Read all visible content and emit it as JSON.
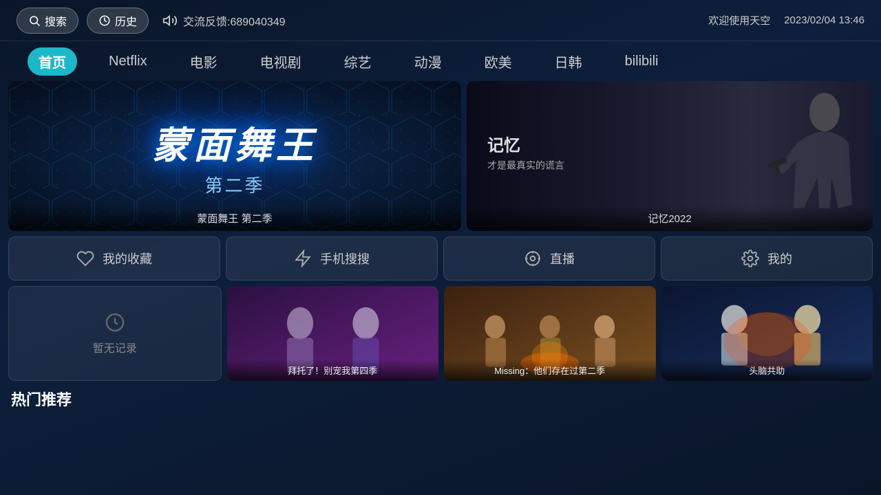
{
  "topbar": {
    "search_label": "搜索",
    "history_label": "历史",
    "feedback_text": "交流反馈:689040349",
    "welcome_text": "欢迎使用天空",
    "datetime": "2023/02/04 13:46"
  },
  "nav": {
    "items": [
      {
        "id": "home",
        "label": "首页",
        "active": true
      },
      {
        "id": "netflix",
        "label": "Netflix",
        "active": false
      },
      {
        "id": "movie",
        "label": "电影",
        "active": false
      },
      {
        "id": "tv",
        "label": "电视剧",
        "active": false
      },
      {
        "id": "variety",
        "label": "综艺",
        "active": false
      },
      {
        "id": "anime",
        "label": "动漫",
        "active": false
      },
      {
        "id": "western",
        "label": "欧美",
        "active": false
      },
      {
        "id": "korean",
        "label": "日韩",
        "active": false
      },
      {
        "id": "bilibili",
        "label": "bilibili",
        "active": false
      }
    ]
  },
  "banners": {
    "left": {
      "title": "蒙面舞王",
      "subtitle": "第二季",
      "label": "蒙面舞王 第二季"
    },
    "right": {
      "main_text": "记忆",
      "sub_text": "才是最真实的谎言",
      "label": "记忆2022"
    }
  },
  "quick_actions": [
    {
      "id": "favorites",
      "label": "我的收藏",
      "icon": "heart"
    },
    {
      "id": "mobile-search",
      "label": "手机搜搜",
      "icon": "zap"
    },
    {
      "id": "live",
      "label": "直播",
      "icon": "circle"
    },
    {
      "id": "mine",
      "label": "我的",
      "icon": "gear"
    }
  ],
  "history": {
    "empty_label": "暂无记录"
  },
  "content_cards": [
    {
      "id": "card1",
      "label": "拜托了！别宠我第四季",
      "has_image": true
    },
    {
      "id": "card2",
      "label": "Missing：他们存在过第二季",
      "has_image": true
    },
    {
      "id": "card3",
      "label": "头脑共助",
      "has_image": true
    }
  ],
  "section": {
    "hot_title": "热门推荐"
  }
}
